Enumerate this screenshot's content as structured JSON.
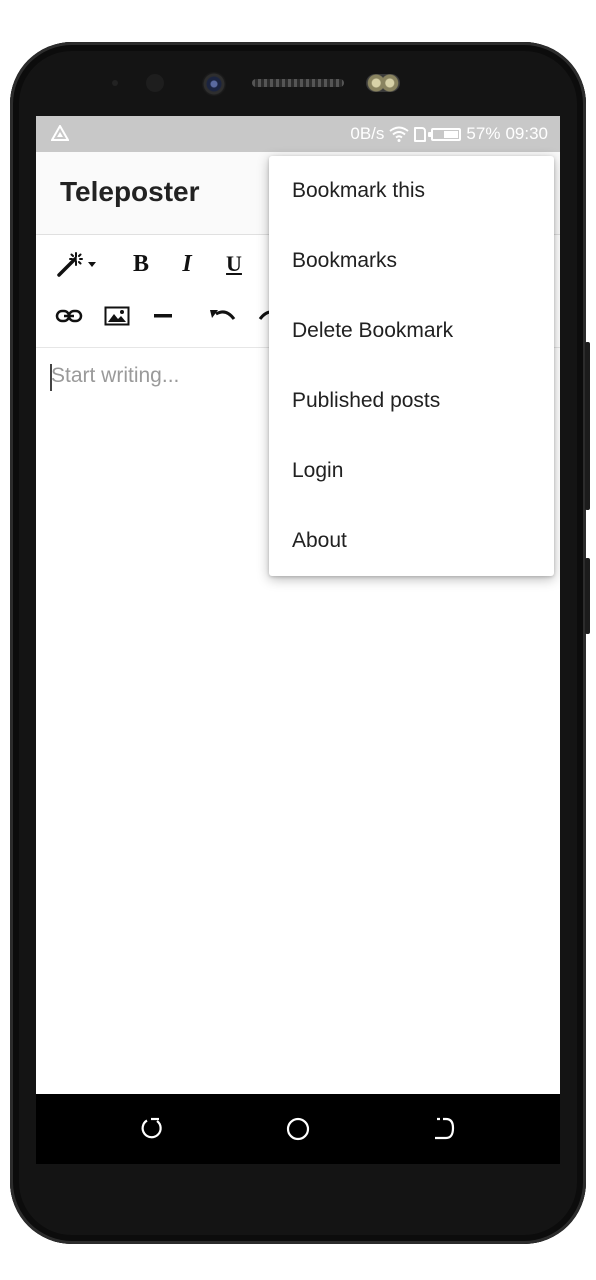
{
  "status_bar": {
    "speed": "0B/s",
    "battery_percent": "57%",
    "battery_level": 0.57,
    "time": "09:30",
    "icons": [
      "nav-arrow-icon",
      "wifi-icon",
      "sim-icon",
      "battery-icon"
    ]
  },
  "app_bar": {
    "title": "Teleposter"
  },
  "toolbar": {
    "row1": [
      "magic-wand-icon",
      "bold",
      "italic",
      "underline"
    ],
    "bold_label": "B",
    "italic_label": "I",
    "underline_label": "U",
    "row2": [
      "link-icon",
      "image-icon",
      "horizontal-rule-icon",
      "undo-icon",
      "redo-icon"
    ]
  },
  "editor": {
    "placeholder": "Start writing..."
  },
  "menu": {
    "items": [
      {
        "label": "Bookmark this"
      },
      {
        "label": "Bookmarks"
      },
      {
        "label": "Delete Bookmark"
      },
      {
        "label": "Published posts"
      },
      {
        "label": "Login"
      },
      {
        "label": "About"
      }
    ]
  },
  "nav_bar": {
    "buttons": [
      "recents-icon",
      "home-icon",
      "back-icon"
    ]
  },
  "colors": {
    "status_bar_bg": "#c8c8c8",
    "app_bar_bg": "#fafafa",
    "nav_bar_bg": "#000000",
    "placeholder_text": "#9a9a9a"
  }
}
